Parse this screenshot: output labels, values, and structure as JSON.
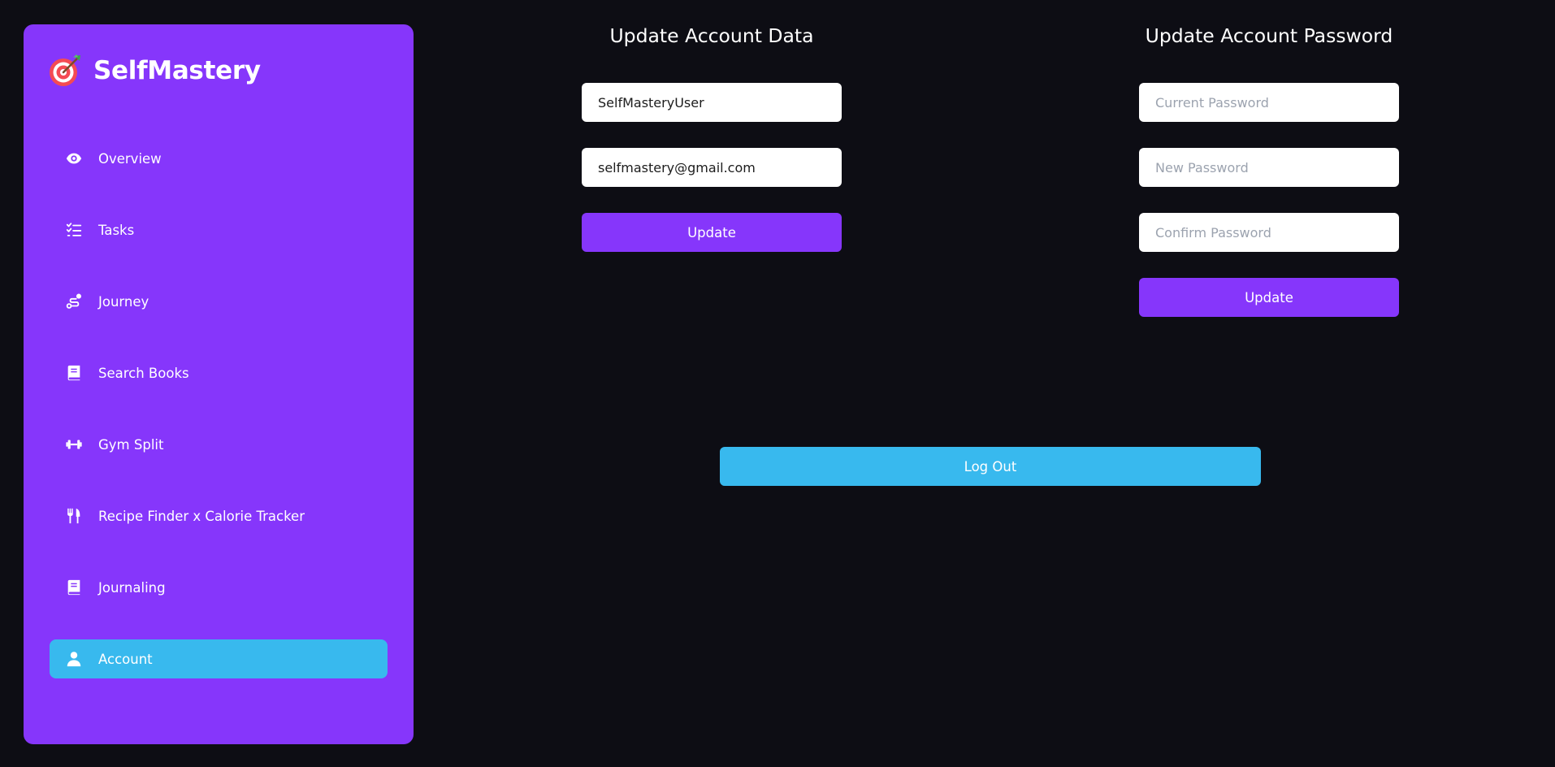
{
  "brand": {
    "name": "SelfMastery",
    "logo_icon": "target-dart-icon"
  },
  "colors": {
    "background": "#0d0d14",
    "sidebar": "#8636fb",
    "accent": "#38b9ee",
    "primary_button": "#8636fb"
  },
  "sidebar": {
    "items": [
      {
        "label": "Overview",
        "icon": "eye-icon",
        "active": false
      },
      {
        "label": "Tasks",
        "icon": "checklist-icon",
        "active": false
      },
      {
        "label": "Journey",
        "icon": "route-icon",
        "active": false
      },
      {
        "label": "Search Books",
        "icon": "book-icon",
        "active": false
      },
      {
        "label": "Gym Split",
        "icon": "dumbbell-icon",
        "active": false
      },
      {
        "label": "Recipe Finder x Calorie Tracker",
        "icon": "utensils-icon",
        "active": false
      },
      {
        "label": "Journaling",
        "icon": "journal-icon",
        "active": false
      },
      {
        "label": "Account",
        "icon": "user-icon",
        "active": true
      }
    ]
  },
  "account_data": {
    "title": "Update Account Data",
    "username_value": "SelfMasteryUser",
    "email_value": "selfmastery@gmail.com",
    "update_label": "Update"
  },
  "account_password": {
    "title": "Update Account Password",
    "current_placeholder": "Current Password",
    "new_placeholder": "New Password",
    "confirm_placeholder": "Confirm Password",
    "update_label": "Update"
  },
  "logout": {
    "label": "Log Out"
  }
}
